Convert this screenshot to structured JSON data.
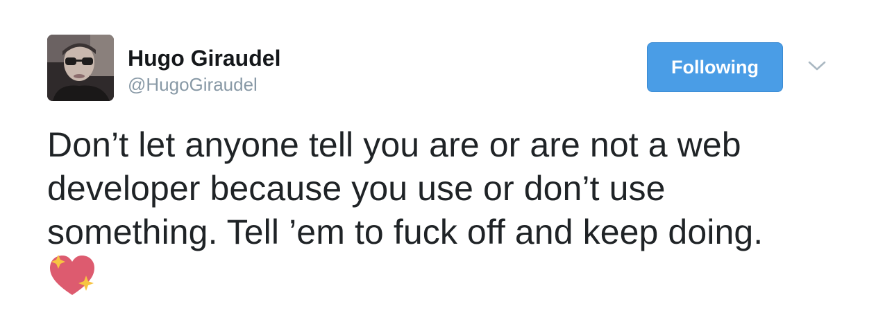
{
  "user": {
    "display_name": "Hugo Giraudel",
    "screen_name": "@HugoGiraudel",
    "avatar_icon": "avatar-photo"
  },
  "actions": {
    "follow_label": "Following",
    "follow_color": "#4a9de6",
    "menu_icon": "chevron-down-icon"
  },
  "tweet": {
    "text": "Don’t let anyone tell you are or are not a web developer because you use or don’t use something. Tell ’em to fuck off and keep doing.",
    "emoji_icon": "sparkling-heart-icon"
  }
}
